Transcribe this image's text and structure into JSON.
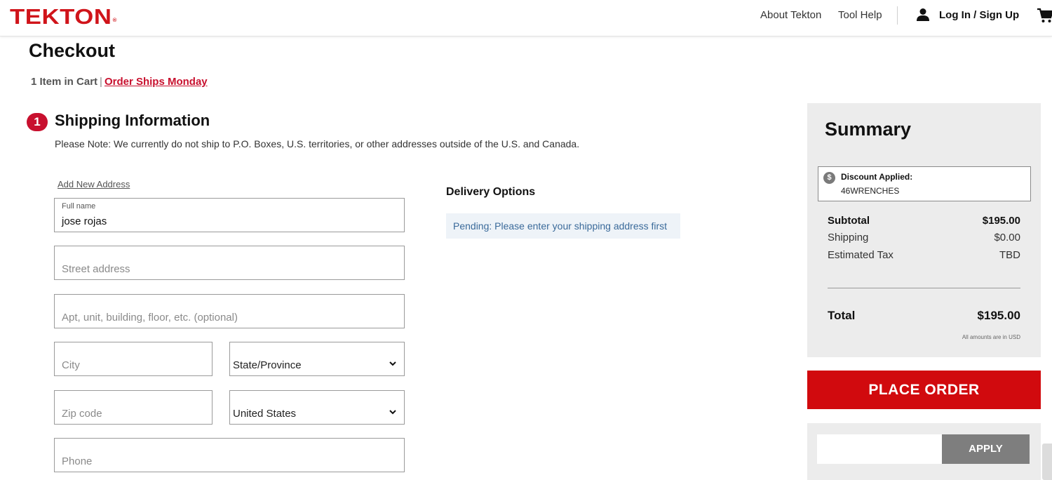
{
  "header": {
    "logo": "TEKTON",
    "logo_mark": "®",
    "nav": {
      "about": "About Tekton",
      "help": "Tool Help",
      "login": "Log In / Sign Up"
    }
  },
  "page": {
    "title": "Checkout",
    "cart_count": "1 Item in Cart",
    "separator": "|",
    "ships": "Order Ships Monday"
  },
  "shipping": {
    "step": "1",
    "title": "Shipping Information",
    "note": "Please Note: We currently do not ship to P.O. Boxes, U.S. territories, or other addresses outside of the U.S. and Canada.",
    "add_address": "Add New Address",
    "full_name": {
      "label": "Full name",
      "value": "jose rojas"
    },
    "street": {
      "placeholder": "Street address"
    },
    "apt": {
      "placeholder": "Apt, unit, building, floor, etc. (optional)"
    },
    "city": {
      "placeholder": "City"
    },
    "state": {
      "value": "State/Province"
    },
    "zip": {
      "placeholder": "Zip code"
    },
    "country": {
      "value": "United States"
    },
    "phone": {
      "placeholder": "Phone"
    }
  },
  "delivery": {
    "title": "Delivery Options",
    "pending": "Pending: Please enter your shipping address first"
  },
  "summary": {
    "title": "Summary",
    "discount_label": "Discount Applied:",
    "discount_code": "46WRENCHES",
    "discount_icon_glyph": "$",
    "subtotal_label": "Subtotal",
    "subtotal_value": "$195.00",
    "shipping_label": "Shipping",
    "shipping_value": "$0.00",
    "tax_label": "Estimated Tax",
    "tax_value": "TBD",
    "total_label": "Total",
    "total_value": "$195.00",
    "currency_note": "All amounts are in USD"
  },
  "actions": {
    "place_order": "PLACE ORDER",
    "apply": "APPLY"
  },
  "colors": {
    "brand_red": "#d0141a",
    "button_red": "#d10a0e",
    "panel_gray": "#ececec",
    "apply_gray": "#7e7e7e"
  }
}
